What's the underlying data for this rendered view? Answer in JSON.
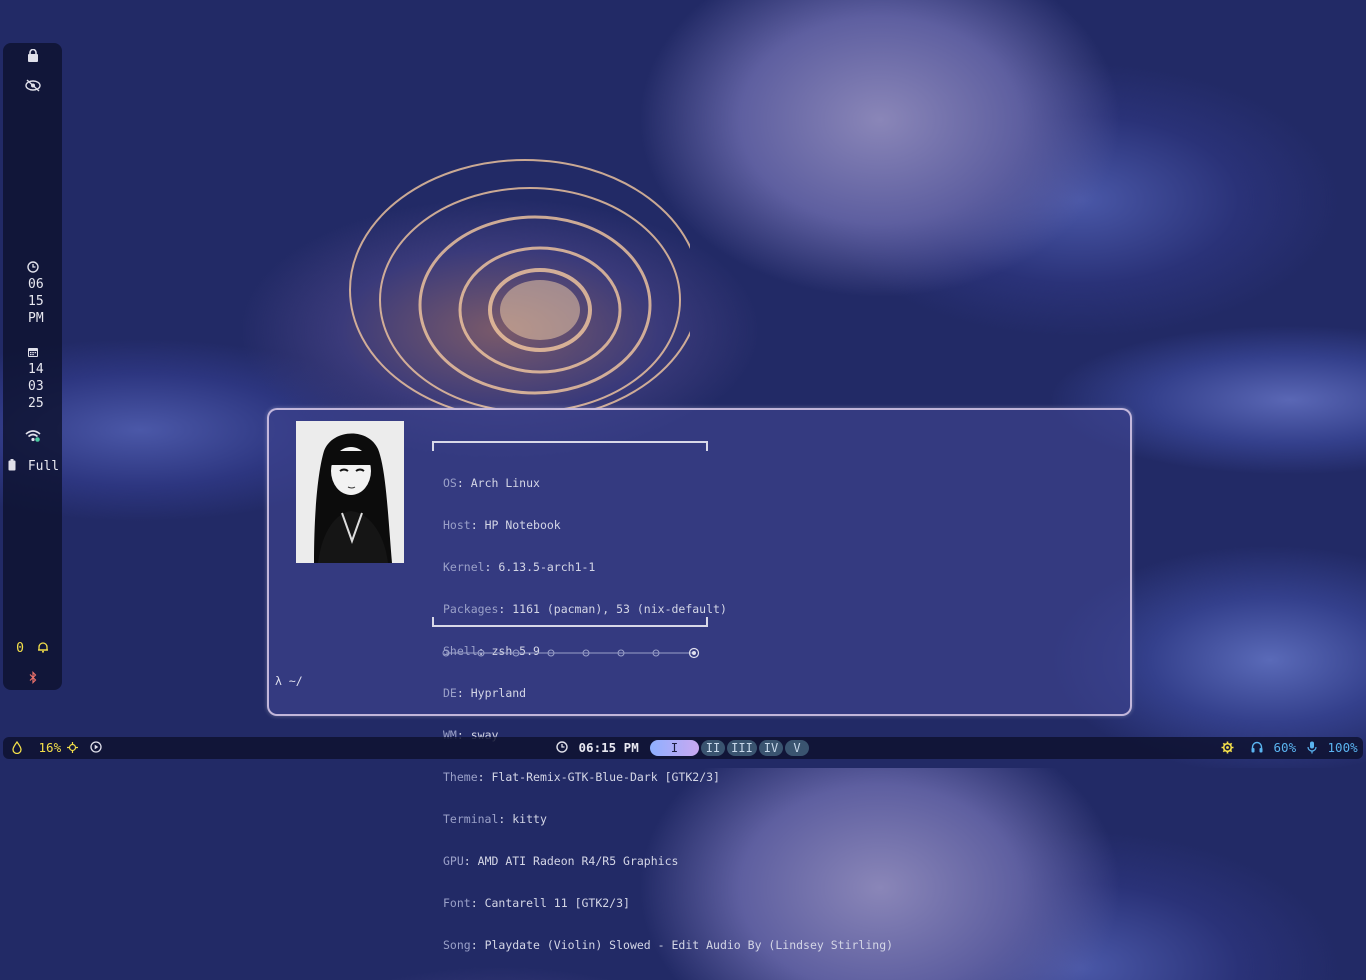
{
  "sidebar": {
    "time": {
      "hour": "06",
      "minute": "15",
      "ampm": "PM"
    },
    "date": {
      "day": "14",
      "month": "03",
      "year": "25"
    },
    "battery_label": "Full",
    "notification_count": "0",
    "icons": [
      "lock-icon",
      "eye-off-icon",
      "clock-icon",
      "calendar-icon",
      "wifi-icon",
      "battery-icon",
      "bell-icon",
      "bluetooth-icon"
    ]
  },
  "terminal": {
    "fetch": [
      {
        "key": "OS",
        "value": "Arch Linux"
      },
      {
        "key": "Host",
        "value": "HP Notebook"
      },
      {
        "key": "Kernel",
        "value": "6.13.5-arch1-1"
      },
      {
        "key": "Packages",
        "value": "1161 (pacman), 53 (nix-default)"
      },
      {
        "key": "Shell",
        "value": "zsh 5.9"
      },
      {
        "key": "DE",
        "value": "Hyprland"
      },
      {
        "key": "WM",
        "value": "sway"
      },
      {
        "key": "Theme",
        "value": "Flat-Remix-GTK-Blue-Dark [GTK2/3]"
      },
      {
        "key": "Terminal",
        "value": "kitty"
      },
      {
        "key": "GPU",
        "value": "AMD ATI Radeon R4/R5 Graphics"
      },
      {
        "key": "Font",
        "value": "Cantarell 11 [GTK2/3]"
      },
      {
        "key": "Song",
        "value": "Playdate (Violin) Slowed - Edit Audio By (Lindsey Stirling)"
      }
    ],
    "prompt": "λ ~/"
  },
  "bottombar": {
    "brightness": "16%",
    "clock": "06:15 PM",
    "workspaces": [
      "I",
      "II",
      "III",
      "IV",
      "V"
    ],
    "active_workspace": "I",
    "volume": "60%",
    "mic": "100%"
  },
  "colors": {
    "accent": "#f4e04a",
    "bar_bg": "#0e1230",
    "terminal_border": "#dccdeb"
  }
}
